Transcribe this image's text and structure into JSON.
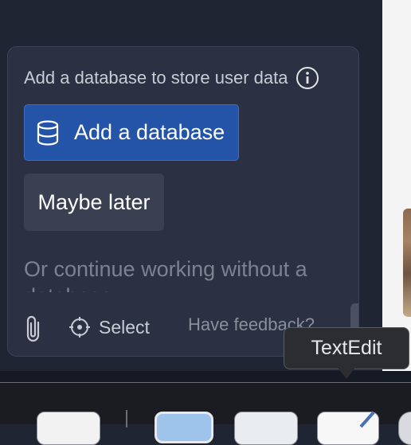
{
  "panel": {
    "prompt": "Add a database to store user data",
    "primary_button": "Add a database",
    "secondary_button": "Maybe later",
    "continue_text": "Or continue working without a database"
  },
  "toolbar": {
    "select_label": "Select",
    "feedback_label": "Have feedback?"
  },
  "tooltip": {
    "text": "TextEdit"
  },
  "colors": {
    "panel_bg": "#2b3142",
    "primary_button": "#2354a8",
    "secondary_button": "#3a4051"
  },
  "icons": {
    "info": "info-icon",
    "database": "database-icon",
    "attach": "paperclip-icon",
    "select": "crosshair-icon",
    "send": "send-icon"
  }
}
